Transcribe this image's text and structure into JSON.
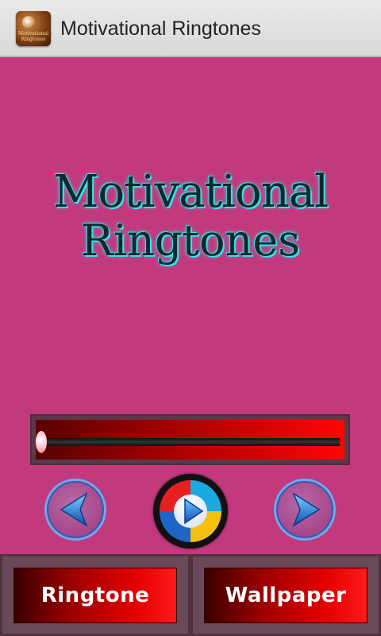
{
  "appbar": {
    "title": "Motivational Ringtones",
    "icon_name": "app-logo-icon",
    "icon_text": [
      "Motivational",
      "Ringtones"
    ]
  },
  "banner": {
    "line1": "Motivational",
    "line2": "Ringtones"
  },
  "player": {
    "progress": 0,
    "prev_icon": "previous-arrow-icon",
    "play_icon": "play-icon",
    "next_icon": "next-arrow-icon"
  },
  "actions": {
    "ringtone_label": "Ringtone",
    "wallpaper_label": "Wallpaper"
  },
  "colors": {
    "background": "#c2397d",
    "appbar": "#e2e2e2",
    "accent_red": "#e50000",
    "banner_glow": "#33e3ea"
  }
}
